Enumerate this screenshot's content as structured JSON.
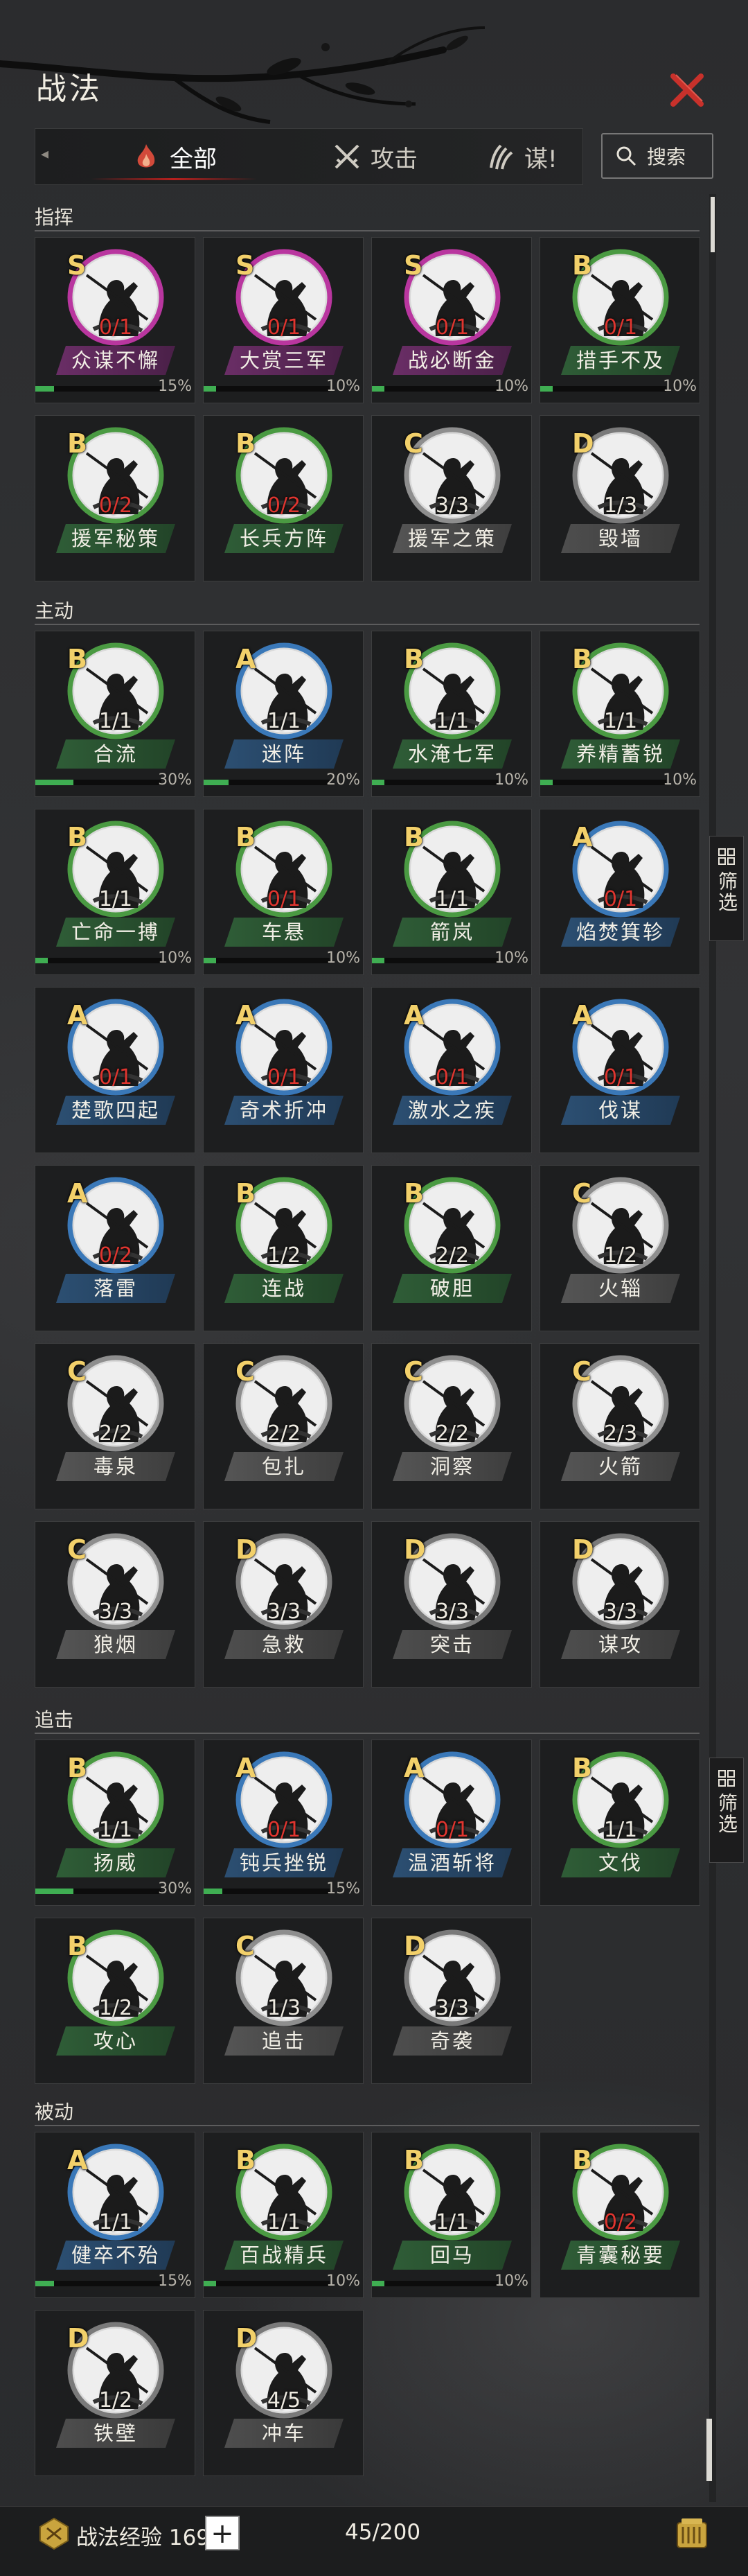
{
  "header": {
    "title": "战法"
  },
  "tabs": [
    {
      "label": "全部",
      "icon": "flame-icon",
      "active": true
    },
    {
      "label": "攻击",
      "icon": "crossed-swords-icon",
      "active": false
    },
    {
      "label": "谋!",
      "icon": "claw-icon",
      "active": false
    }
  ],
  "search": {
    "label": "搜索"
  },
  "filter": {
    "label": "筛选"
  },
  "colors": {
    "S": "#b9369f",
    "A": "#3a78b8",
    "B": "#4a9a42",
    "C": "#8e8e8e",
    "D": "#7a7a7a",
    "red": "#e0352f",
    "progress": "#3fae52"
  },
  "sections": [
    {
      "title": "指挥",
      "cards": [
        {
          "grade": "S",
          "count": "0/1",
          "name": "众谋不懈",
          "progress": "15%"
        },
        {
          "grade": "S",
          "count": "0/1",
          "name": "大赏三军",
          "progress": "10%"
        },
        {
          "grade": "S",
          "count": "0/1",
          "name": "战必断金",
          "progress": "10%"
        },
        {
          "grade": "B",
          "count": "0/1",
          "name": "措手不及",
          "progress": "10%"
        },
        {
          "grade": "B",
          "count": "0/2",
          "name": "援军秘策",
          "progress": ""
        },
        {
          "grade": "B",
          "count": "0/2",
          "name": "长兵方阵",
          "progress": ""
        },
        {
          "grade": "C",
          "count": "3/3",
          "name": "援军之策",
          "progress": ""
        },
        {
          "grade": "D",
          "count": "1/3",
          "name": "毁墙",
          "progress": ""
        }
      ]
    },
    {
      "title": "主动",
      "cards": [
        {
          "grade": "B",
          "count": "1/1",
          "name": "合流",
          "progress": "30%"
        },
        {
          "grade": "A",
          "count": "1/1",
          "name": "迷阵",
          "progress": "20%"
        },
        {
          "grade": "B",
          "count": "1/1",
          "name": "水淹七军",
          "progress": "10%"
        },
        {
          "grade": "B",
          "count": "1/1",
          "name": "养精蓄锐",
          "progress": "10%"
        },
        {
          "grade": "B",
          "count": "1/1",
          "name": "亡命一搏",
          "progress": "10%"
        },
        {
          "grade": "B",
          "count": "0/1",
          "name": "车悬",
          "progress": "10%"
        },
        {
          "grade": "B",
          "count": "1/1",
          "name": "箭岚",
          "progress": "10%"
        },
        {
          "grade": "A",
          "count": "0/1",
          "name": "焰焚箕轸",
          "progress": ""
        },
        {
          "grade": "A",
          "count": "0/1",
          "name": "楚歌四起",
          "progress": ""
        },
        {
          "grade": "A",
          "count": "0/1",
          "name": "奇术折冲",
          "progress": ""
        },
        {
          "grade": "A",
          "count": "0/1",
          "name": "激水之疾",
          "progress": ""
        },
        {
          "grade": "A",
          "count": "0/1",
          "name": "伐谋",
          "progress": ""
        },
        {
          "grade": "A",
          "count": "0/2",
          "name": "落雷",
          "progress": ""
        },
        {
          "grade": "B",
          "count": "1/2",
          "name": "连战",
          "progress": ""
        },
        {
          "grade": "B",
          "count": "2/2",
          "name": "破胆",
          "progress": ""
        },
        {
          "grade": "C",
          "count": "1/2",
          "name": "火辎",
          "progress": ""
        },
        {
          "grade": "C",
          "count": "2/2",
          "name": "毒泉",
          "progress": ""
        },
        {
          "grade": "C",
          "count": "2/2",
          "name": "包扎",
          "progress": ""
        },
        {
          "grade": "C",
          "count": "2/2",
          "name": "洞察",
          "progress": ""
        },
        {
          "grade": "C",
          "count": "2/3",
          "name": "火箭",
          "progress": ""
        },
        {
          "grade": "C",
          "count": "3/3",
          "name": "狼烟",
          "progress": ""
        },
        {
          "grade": "D",
          "count": "3/3",
          "name": "急救",
          "progress": ""
        },
        {
          "grade": "D",
          "count": "3/3",
          "name": "突击",
          "progress": ""
        },
        {
          "grade": "D",
          "count": "3/3",
          "name": "谋攻",
          "progress": ""
        }
      ]
    },
    {
      "title": "追击",
      "cards": [
        {
          "grade": "B",
          "count": "1/1",
          "name": "扬威",
          "progress": "30%"
        },
        {
          "grade": "A",
          "count": "0/1",
          "name": "钝兵挫锐",
          "progress": "15%"
        },
        {
          "grade": "A",
          "count": "0/1",
          "name": "温酒斩将",
          "progress": ""
        },
        {
          "grade": "B",
          "count": "1/1",
          "name": "文伐",
          "progress": ""
        },
        {
          "grade": "B",
          "count": "1/2",
          "name": "攻心",
          "progress": ""
        },
        {
          "grade": "C",
          "count": "1/3",
          "name": "追击",
          "progress": ""
        },
        {
          "grade": "D",
          "count": "3/3",
          "name": "奇袭",
          "progress": ""
        }
      ]
    },
    {
      "title": "被动",
      "cards": [
        {
          "grade": "A",
          "count": "1/1",
          "name": "健卒不殆",
          "progress": "15%"
        },
        {
          "grade": "B",
          "count": "1/1",
          "name": "百战精兵",
          "progress": "10%"
        },
        {
          "grade": "B",
          "count": "1/1",
          "name": "回马",
          "progress": "10%"
        },
        {
          "grade": "B",
          "count": "0/2",
          "name": "青囊秘要",
          "progress": ""
        },
        {
          "grade": "D",
          "count": "1/2",
          "name": "铁壁",
          "progress": ""
        },
        {
          "grade": "D",
          "count": "4/5",
          "name": "冲车",
          "progress": ""
        }
      ]
    }
  ],
  "footer": {
    "xp_label": "战法经验 169",
    "plus": "+",
    "capacity": "45/200"
  }
}
